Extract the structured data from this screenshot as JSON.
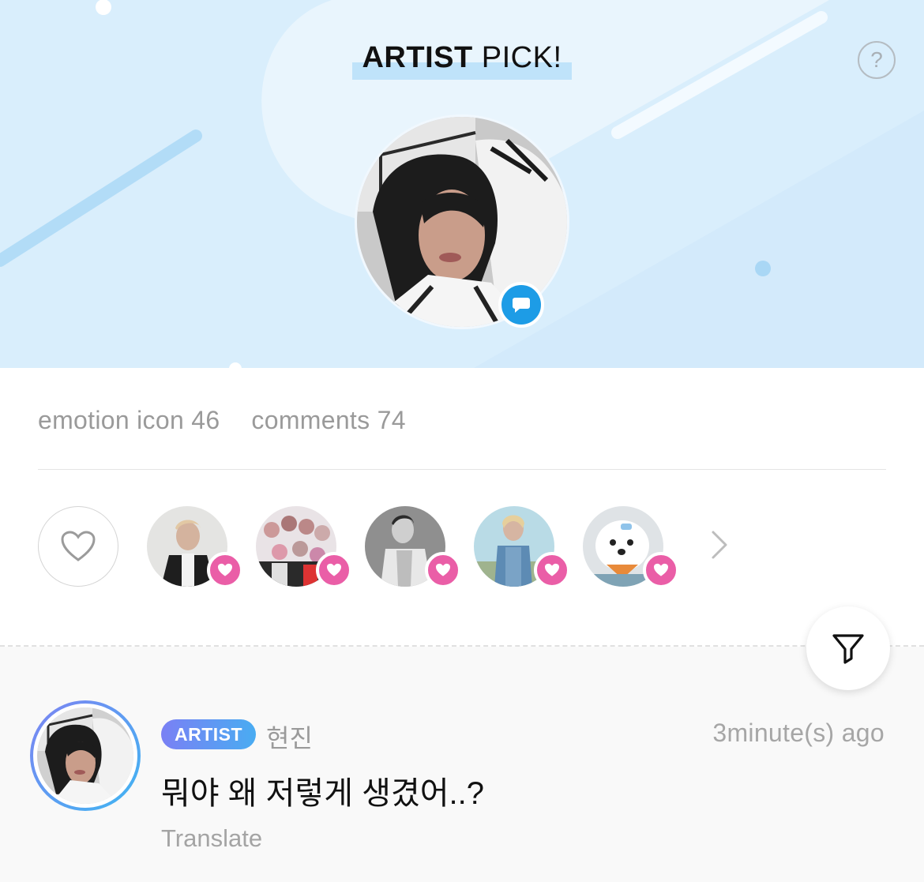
{
  "header": {
    "title_bold": "ARTIST",
    "title_light": "PICK!",
    "help_label": "?"
  },
  "stats": {
    "emotion_label": "emotion icon 46",
    "comments_label": "comments 74"
  },
  "reactions": {
    "reactor_count_shown": 5,
    "heart_color": "#ea5ea7"
  },
  "comment": {
    "badge": "ARTIST",
    "author": "현진",
    "time": "3minute(s) ago",
    "text": "뭐야 왜 저렇게 생겼어..?",
    "translate_label": "Translate"
  },
  "colors": {
    "banner_bg": "#d9eefc",
    "accent_blue": "#1d9ce6",
    "badge_gradient_start": "#7a80f4",
    "badge_gradient_end": "#49acf2"
  }
}
